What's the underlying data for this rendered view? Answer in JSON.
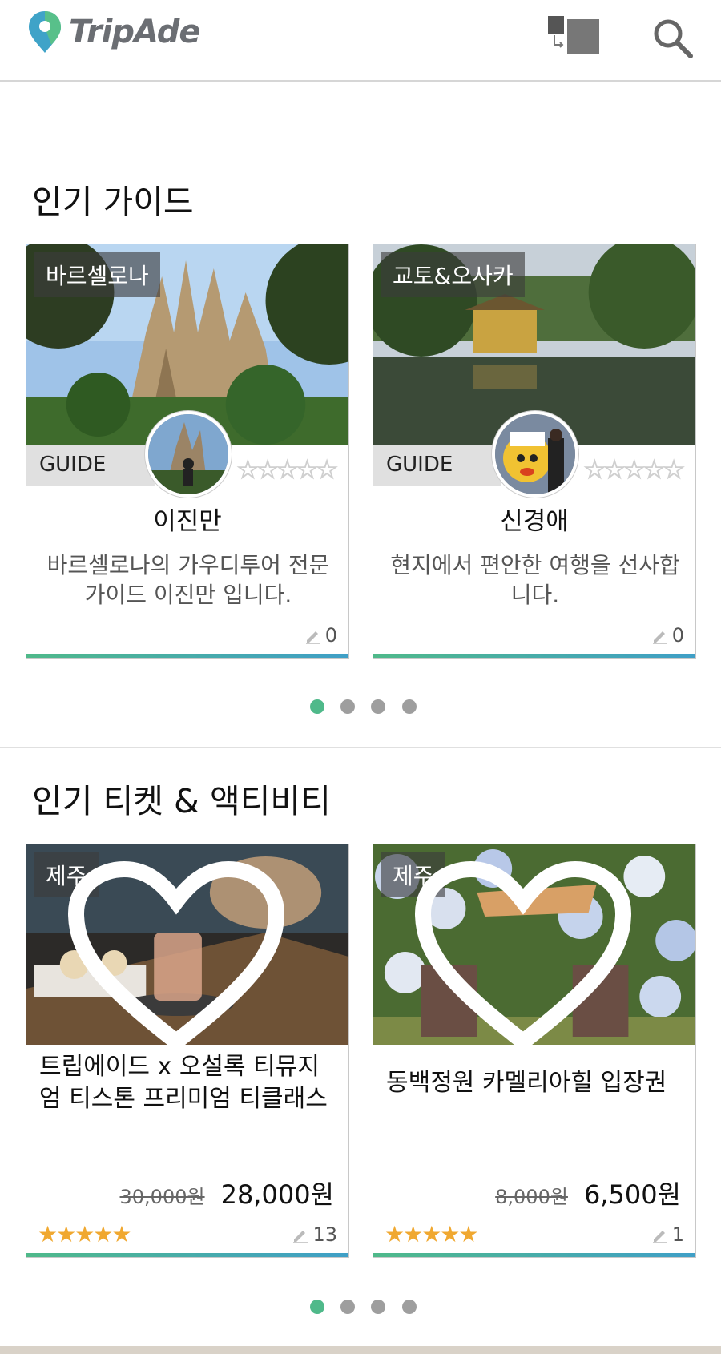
{
  "header": {
    "brand": "TripAde"
  },
  "guides": {
    "title": "인기 가이드",
    "role_label": "GUIDE",
    "stars_empty": "☆☆☆☆☆",
    "items": [
      {
        "city": "바르셀로나",
        "name": "이진만",
        "desc": "바르셀로나의 가우디투어 전문 가이드 이진만 입니다.",
        "reviews": "0"
      },
      {
        "city": "교토&오사카",
        "name": "신경애",
        "desc": "현지에서 편안한 여행을 선사합니다.",
        "reviews": "0"
      }
    ],
    "pager": {
      "count": 4,
      "active": 1
    }
  },
  "tickets": {
    "title": "인기 티켓 & 액티비티",
    "items": [
      {
        "city": "제주",
        "title": "트립에이드 x 오설록 티뮤지엄 티스톤 프리미엄 티클래스",
        "old_price": "30,000원",
        "price": "28,000원",
        "stars": "★★★★★",
        "reviews": "13"
      },
      {
        "city": "제주",
        "title": "동백정원 카멜리아힐 입장권",
        "old_price": "8,000원",
        "price": "6,500원",
        "stars": "★★★★★",
        "reviews": "1"
      }
    ],
    "pager": {
      "count": 4,
      "active": 1
    }
  },
  "icons": {
    "logo": "map-pin-logo-icon",
    "translate": "translate-icon",
    "search": "search-icon",
    "heart": "heart-outline-icon",
    "pencil": "pencil-icon"
  },
  "colors": {
    "accent_green": "#4fb98a",
    "accent_blue": "#3f9fc7",
    "star_gold": "#f0a830",
    "pager_inactive": "#9e9e9e"
  }
}
